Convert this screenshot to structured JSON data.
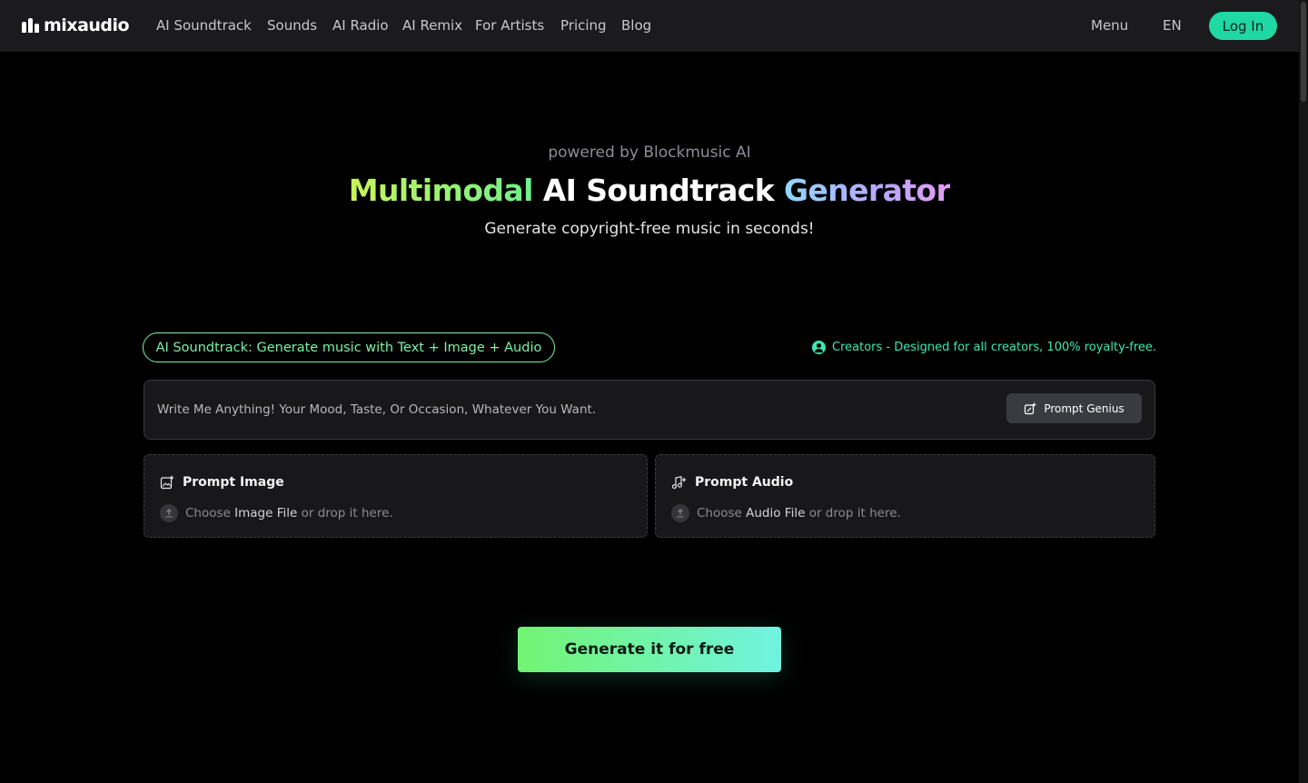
{
  "brand": {
    "name": "mixaudio"
  },
  "nav": {
    "items": [
      {
        "label": "AI Soundtrack"
      },
      {
        "label": "Sounds"
      },
      {
        "label": "AI Radio"
      },
      {
        "label": "AI Remix"
      },
      {
        "label": "For Artists"
      },
      {
        "label": "Pricing"
      },
      {
        "label": "Blog"
      }
    ],
    "menu_label": "Menu",
    "language": "EN",
    "login_label": "Log In"
  },
  "hero": {
    "powered_by": "powered by Blockmusic AI",
    "title_part1": "Multimodal",
    "title_part2": "AI Soundtrack",
    "title_part3": "Generator",
    "subtitle": "Generate copyright-free music in seconds!"
  },
  "mode": {
    "pill_label": "AI Soundtrack: Generate music with Text + Image + Audio",
    "creators_text": "Creators - Designed for all creators, 100% royalty-free."
  },
  "prompt": {
    "value": "",
    "placeholder": "Write Me Anything! Your Mood, Taste, Or Occasion, Whatever You Want.",
    "genius_label": "Prompt Genius"
  },
  "uploads": {
    "image": {
      "title": "Prompt Image",
      "choose_prefix": "Choose ",
      "choose_link": "Image File",
      "suffix": " or drop it here."
    },
    "audio": {
      "title": "Prompt Audio",
      "choose_prefix": "Choose ",
      "choose_link": "Audio File",
      "suffix": " or drop it here."
    }
  },
  "generate": {
    "label": "Generate it for free"
  },
  "colors": {
    "accent": "#1fd8a4",
    "mint": "#7bf3a3",
    "background": "#000000",
    "navbar": "#1b1b1d"
  }
}
